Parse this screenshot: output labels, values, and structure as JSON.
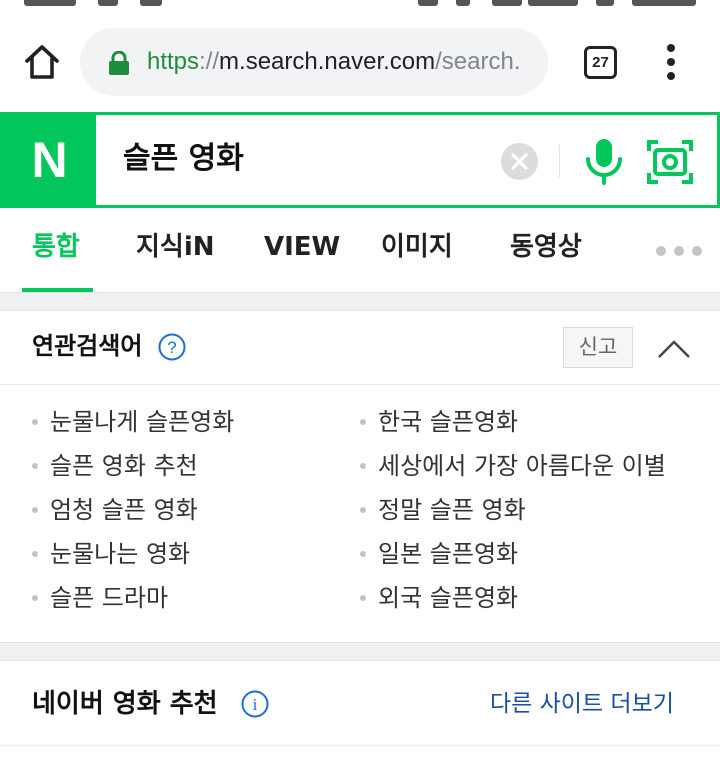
{
  "browser": {
    "url_scheme": "https",
    "url_separator": "://",
    "url_host": "m.search.naver.com",
    "url_path": "/search.",
    "tab_count": "27"
  },
  "search": {
    "logo": "N",
    "query": "슬픈 영화",
    "accent_color": "#03c75a"
  },
  "tabs": [
    "통합",
    "지식iN",
    "VIEW",
    "이미지",
    "동영상"
  ],
  "related": {
    "title": "연관검색어",
    "help_label": "?",
    "report_label": "신고",
    "keywords_left": [
      "눈물나게 슬픈영화",
      "슬픈 영화 추천",
      "엄청 슬픈 영화",
      "눈물나는 영화",
      "슬픈 드라마"
    ],
    "keywords_right": [
      "한국 슬픈영화",
      "세상에서 가장 아름다운 이별",
      "정말 슬픈 영화",
      "일본 슬픈영화",
      "외국 슬픈영화"
    ]
  },
  "movie": {
    "title": "네이버 영화 추천",
    "info_label": "i",
    "more_label": "다른 사이트 더보기",
    "link_color": "#1a4fa3"
  }
}
